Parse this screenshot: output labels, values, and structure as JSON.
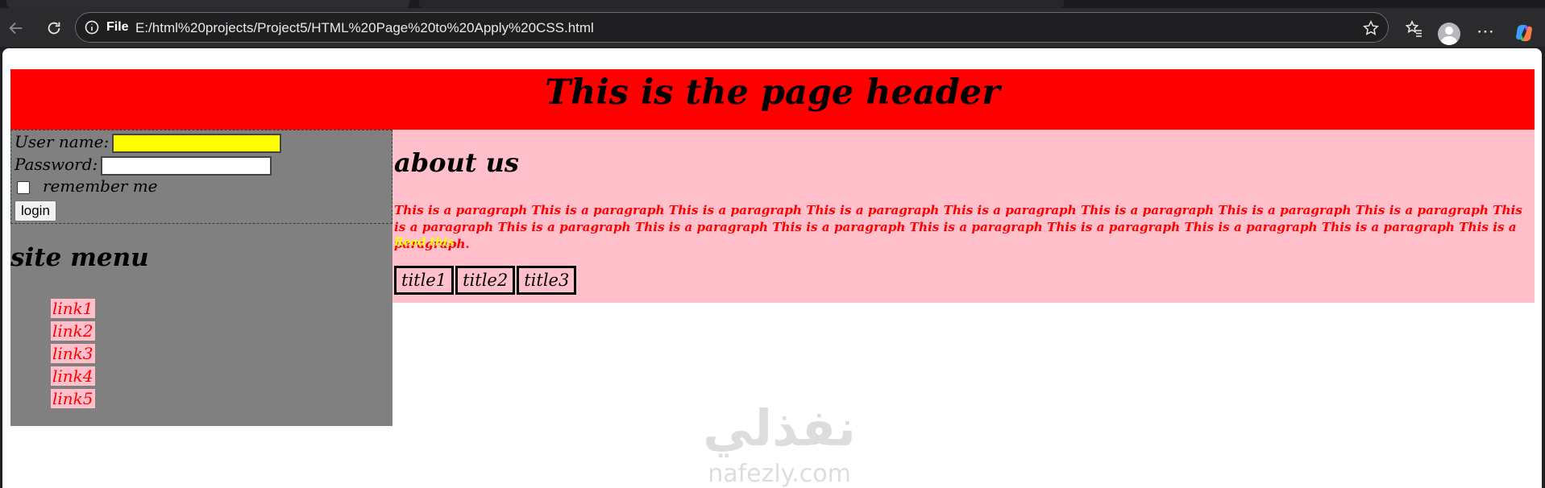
{
  "browser": {
    "scheme": "File",
    "url": "E:/html%20projects/Project5/HTML%20Page%20to%20Apply%20CSS.html"
  },
  "page": {
    "header": "This is the page header",
    "login": {
      "username_label": "User name:",
      "password_label": "Password:",
      "remember_label": "remember me",
      "button": "login"
    },
    "menu": {
      "title": "site menu",
      "links": [
        "link1",
        "link2",
        "link3",
        "link4",
        "link5"
      ]
    },
    "about": {
      "title": "about us",
      "paragraph": "This is a paragraph This is a paragraph This is a paragraph This is a paragraph This is a paragraph This is a paragraph This is a paragraph This is a paragraph This is a paragraph This is a paragraph This is a paragraph This is a paragraph This is a paragraph This is a paragraph This is a paragraph This is a paragraph This is a paragraph.",
      "read_more": "Read this",
      "table_cells": [
        "title1",
        "title2",
        "title3"
      ]
    }
  },
  "watermark": {
    "arabic": "نفذلي",
    "latin": "nafezly.com"
  },
  "colors": {
    "header_bg": "#ff0000",
    "sidebar_bg": "#808080",
    "main_bg": "#ffc0cb",
    "username_field_bg": "#ffff00",
    "paragraph_text": "#ff0000",
    "read_more_text": "#ffff00"
  },
  "icons": [
    "back-arrow-icon",
    "reload-icon",
    "info-icon",
    "star-icon",
    "favorites-icon",
    "avatar-icon",
    "more-icon",
    "copilot-icon"
  ]
}
